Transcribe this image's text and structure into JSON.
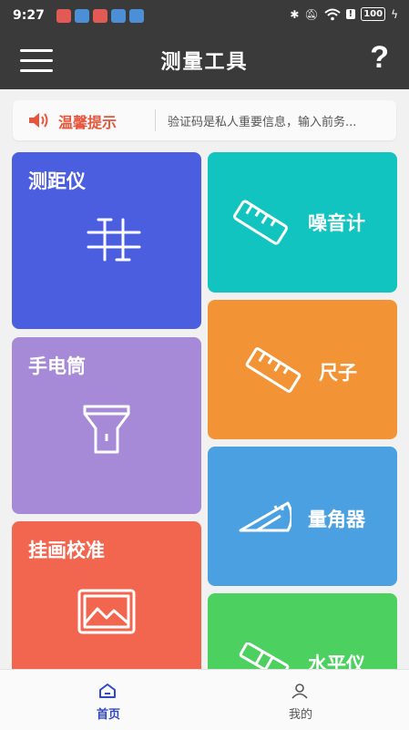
{
  "status_bar": {
    "time": "9:27",
    "battery": "100",
    "app_icon_colors": [
      "#e25a55",
      "#4c8fd6",
      "#e25a55",
      "#4c8fd6",
      "#4c8fd6"
    ]
  },
  "header": {
    "title": "测量工具",
    "help_label": "?"
  },
  "notice": {
    "label": "温馨提示",
    "text": "验证码是私人重要信息，输入前务..."
  },
  "tools": [
    {
      "id": "rangefinder",
      "label": "测距仪",
      "icon": "rangefinder-icon",
      "color": "#4b5ee0"
    },
    {
      "id": "noise-meter",
      "label": "噪音计",
      "icon": "ruler-icon",
      "color": "#12c4c0"
    },
    {
      "id": "flashlight",
      "label": "手电筒",
      "icon": "flashlight-icon",
      "color": "#a68ad8"
    },
    {
      "id": "ruler",
      "label": "尺子",
      "icon": "ruler-icon",
      "color": "#f29436"
    },
    {
      "id": "picture-calibration",
      "label": "挂画校准",
      "icon": "picture-icon",
      "color": "#f26650"
    },
    {
      "id": "protractor",
      "label": "量角器",
      "icon": "protractor-icon",
      "color": "#4aa0e0"
    },
    {
      "id": "level",
      "label": "水平仪",
      "icon": "level-icon",
      "color": "#4cd060"
    }
  ],
  "bottom_nav": [
    {
      "label": "首页",
      "icon": "home-icon",
      "active": true
    },
    {
      "label": "我的",
      "icon": "user-icon",
      "active": false
    }
  ],
  "colors": {
    "header_bg": "#3a3a3a",
    "notice_accent": "#e8553d",
    "nav_active": "#2f47c9",
    "nav_inactive": "#555555"
  }
}
